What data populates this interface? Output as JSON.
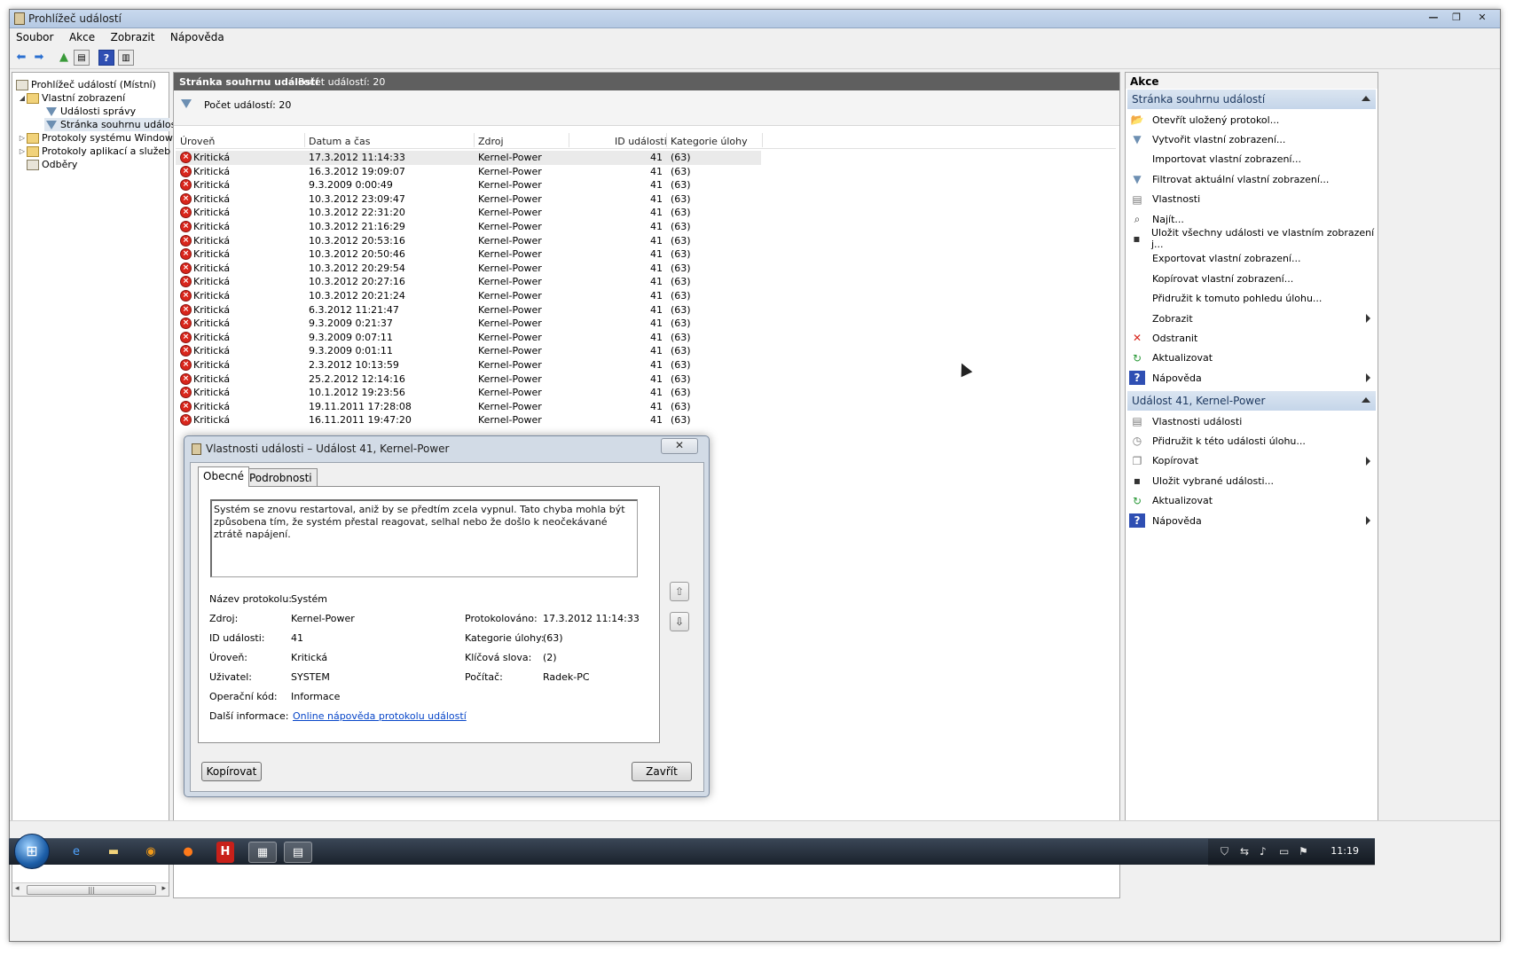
{
  "window": {
    "title": "Prohlížeč událostí",
    "controls": [
      "—",
      "❐",
      "✕"
    ]
  },
  "menu": [
    "Soubor",
    "Akce",
    "Zobrazit",
    "Nápověda"
  ],
  "tree": {
    "items": [
      {
        "label": "Prohlížeč událostí (Místní)",
        "icon": "app-icon"
      },
      {
        "label": "Vlastní zobrazení",
        "icon": "folder-icon",
        "expander": "◢"
      },
      {
        "label": "Události správy",
        "icon": "filter-icon"
      },
      {
        "label": "Stránka souhrnu událostí",
        "icon": "filter-icon"
      },
      {
        "label": "Protokoly systému Windows",
        "icon": "folder-icon",
        "expander": "▷"
      },
      {
        "label": "Protokoly aplikací a služeb",
        "icon": "folder-icon",
        "expander": "▷"
      },
      {
        "label": "Odběry",
        "icon": "doc-icon"
      }
    ]
  },
  "center": {
    "header_title": "Stránka souhrnu událostí",
    "header_count": "Počet událostí: 20",
    "filter_count": "Počet událostí: 20",
    "columns": [
      "Úroveň",
      "Datum a čas",
      "Zdroj",
      "ID události",
      "Kategorie úlohy"
    ],
    "rows": [
      {
        "level": "Kritická",
        "date": "17.3.2012 11:14:33",
        "source": "Kernel-Power",
        "id": "41",
        "category": "(63)"
      },
      {
        "level": "Kritická",
        "date": "16.3.2012 19:09:07",
        "source": "Kernel-Power",
        "id": "41",
        "category": "(63)"
      },
      {
        "level": "Kritická",
        "date": "9.3.2009 0:00:49",
        "source": "Kernel-Power",
        "id": "41",
        "category": "(63)"
      },
      {
        "level": "Kritická",
        "date": "10.3.2012 23:09:47",
        "source": "Kernel-Power",
        "id": "41",
        "category": "(63)"
      },
      {
        "level": "Kritická",
        "date": "10.3.2012 22:31:20",
        "source": "Kernel-Power",
        "id": "41",
        "category": "(63)"
      },
      {
        "level": "Kritická",
        "date": "10.3.2012 21:16:29",
        "source": "Kernel-Power",
        "id": "41",
        "category": "(63)"
      },
      {
        "level": "Kritická",
        "date": "10.3.2012 20:53:16",
        "source": "Kernel-Power",
        "id": "41",
        "category": "(63)"
      },
      {
        "level": "Kritická",
        "date": "10.3.2012 20:50:46",
        "source": "Kernel-Power",
        "id": "41",
        "category": "(63)"
      },
      {
        "level": "Kritická",
        "date": "10.3.2012 20:29:54",
        "source": "Kernel-Power",
        "id": "41",
        "category": "(63)"
      },
      {
        "level": "Kritická",
        "date": "10.3.2012 20:27:16",
        "source": "Kernel-Power",
        "id": "41",
        "category": "(63)"
      },
      {
        "level": "Kritická",
        "date": "10.3.2012 20:21:24",
        "source": "Kernel-Power",
        "id": "41",
        "category": "(63)"
      },
      {
        "level": "Kritická",
        "date": "6.3.2012 11:21:47",
        "source": "Kernel-Power",
        "id": "41",
        "category": "(63)"
      },
      {
        "level": "Kritická",
        "date": "9.3.2009 0:21:37",
        "source": "Kernel-Power",
        "id": "41",
        "category": "(63)"
      },
      {
        "level": "Kritická",
        "date": "9.3.2009 0:07:11",
        "source": "Kernel-Power",
        "id": "41",
        "category": "(63)"
      },
      {
        "level": "Kritická",
        "date": "9.3.2009 0:01:11",
        "source": "Kernel-Power",
        "id": "41",
        "category": "(63)"
      },
      {
        "level": "Kritická",
        "date": "2.3.2012 10:13:59",
        "source": "Kernel-Power",
        "id": "41",
        "category": "(63)"
      },
      {
        "level": "Kritická",
        "date": "25.2.2012 12:14:16",
        "source": "Kernel-Power",
        "id": "41",
        "category": "(63)"
      },
      {
        "level": "Kritická",
        "date": "10.1.2012 19:23:56",
        "source": "Kernel-Power",
        "id": "41",
        "category": "(63)"
      },
      {
        "level": "Kritická",
        "date": "19.11.2011 17:28:08",
        "source": "Kernel-Power",
        "id": "41",
        "category": "(63)"
      },
      {
        "level": "Kritická",
        "date": "16.11.2011 19:47:20",
        "source": "Kernel-Power",
        "id": "41",
        "category": "(63)"
      }
    ]
  },
  "dialog": {
    "title": "Vlastnosti události – Událost 41, Kernel-Power",
    "close": "✕",
    "tabs": [
      "Obecné",
      "Podrobnosti"
    ],
    "description": "Systém se znovu restartoval, aniž by se předtím zcela vypnul. Tato chyba mohla být způsobena tím, že systém přestal reagovat, selhal nebo že došlo k neočekávané ztrátě napájení.",
    "fields": {
      "log_name_label": "Název protokolu:",
      "log_name": "Systém",
      "source_label": "Zdroj:",
      "source": "Kernel-Power",
      "logged_label": "Protokolováno:",
      "logged": "17.3.2012 11:14:33",
      "event_id_label": "ID události:",
      "event_id": "41",
      "task_cat_label": "Kategorie úlohy:",
      "task_cat": "(63)",
      "level_label": "Úroveň:",
      "level": "Kritická",
      "keywords_label": "Klíčová slova:",
      "keywords": "(2)",
      "user_label": "Uživatel:",
      "user": "SYSTEM",
      "computer_label": "Počítač:",
      "computer": "Radek-PC",
      "opcode_label": "Operační kód:",
      "opcode": "Informace",
      "more_info_label": "Další informace:",
      "more_info_link": "Online nápověda protokolu událostí"
    },
    "copy_button": "Kopírovat",
    "close_button": "Zavřít"
  },
  "actions": {
    "header": "Akce",
    "section1": "Stránka souhrnu událostí",
    "section1_items": [
      {
        "label": "Otevřít uložený protokol...",
        "icon": "folder-open-icon"
      },
      {
        "label": "Vytvořit vlastní zobrazení...",
        "icon": "filter-icon"
      },
      {
        "label": "Importovat vlastní zobrazení...",
        "icon": ""
      },
      {
        "label": "Filtrovat aktuální vlastní zobrazení...",
        "icon": "filter-icon"
      },
      {
        "label": "Vlastnosti",
        "icon": "properties-icon"
      },
      {
        "label": "Najít...",
        "icon": "find-icon"
      },
      {
        "label": "Uložit všechny události ve vlastním zobrazení j...",
        "icon": "save-icon"
      },
      {
        "label": "Exportovat vlastní zobrazení...",
        "icon": ""
      },
      {
        "label": "Kopírovat vlastní zobrazení...",
        "icon": ""
      },
      {
        "label": "Přidružit k tomuto pohledu úlohu...",
        "icon": ""
      },
      {
        "label": "Zobrazit",
        "icon": "",
        "submenu": true
      },
      {
        "label": "Odstranit",
        "icon": "delete-icon"
      },
      {
        "label": "Aktualizovat",
        "icon": "refresh-icon"
      },
      {
        "label": "Nápověda",
        "icon": "help-icon",
        "submenu": true
      }
    ],
    "section2": "Událost 41, Kernel-Power",
    "section2_items": [
      {
        "label": "Vlastnosti události",
        "icon": "properties-icon"
      },
      {
        "label": "Přidružit k této události úlohu...",
        "icon": "task-icon"
      },
      {
        "label": "Kopírovat",
        "icon": "copy-icon",
        "submenu": true
      },
      {
        "label": "Uložit vybrané události...",
        "icon": "save-icon"
      },
      {
        "label": "Aktualizovat",
        "icon": "refresh-icon"
      },
      {
        "label": "Nápověda",
        "icon": "help-icon",
        "submenu": true
      }
    ]
  },
  "taskbar": {
    "clock": "11:19",
    "apps": [
      "ie-icon",
      "explorer-icon",
      "avast-icon",
      "firefox-icon",
      "h-icon",
      "network-icon",
      "event-viewer-icon"
    ]
  },
  "colors": {
    "critical": "#d9261c",
    "header_dark": "#5f5f5f",
    "section_blue": "#c5d5e9",
    "link": "#0645c8"
  }
}
